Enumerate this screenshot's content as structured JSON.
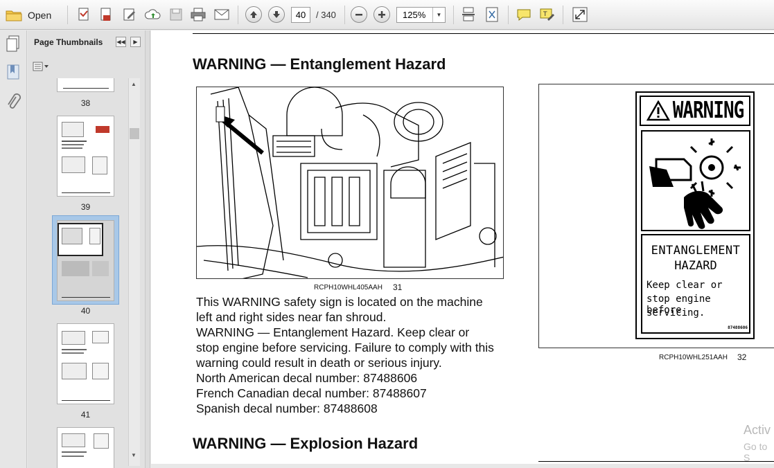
{
  "toolbar": {
    "open_label": "Open",
    "page_current": "40",
    "page_total": "/ 340",
    "zoom": "125%"
  },
  "sidebar": {
    "title": "Page Thumbnails",
    "thumbnails": [
      {
        "page": "38"
      },
      {
        "page": "39"
      },
      {
        "page": "40",
        "selected": true
      },
      {
        "page": "41"
      }
    ]
  },
  "document": {
    "heading1": "WARNING — Entanglement Hazard",
    "figure1_caption_code": "RCPH10WHL405AAH",
    "figure1_caption_num": "31",
    "figure2_caption_code": "RCPH10WHL251AAH",
    "figure2_caption_num": "32",
    "decal": {
      "header": "WARNING",
      "title1": "ENTANGLEMENT",
      "title2": "HAZARD",
      "line1": "Keep clear or",
      "line2": "stop engine before",
      "line3": "servicing.",
      "part_no": "87488606"
    },
    "body_lines": [
      "This WARNING safety sign is located on the machine",
      "left and right sides near fan shroud.",
      "WARNING — Entanglement Hazard.  Keep clear or",
      "stop engine before servicing.  Failure to comply with this",
      "warning could result in death or serious injury.",
      "North American decal number:  87488606",
      "French Canadian decal number:  87488607",
      "Spanish decal number:  87488608"
    ],
    "heading2": "WARNING — Explosion Hazard",
    "watermark_line1": "Activ",
    "watermark_line2": "Go to S"
  },
  "colors": {
    "selection": "#a8c8e8",
    "toolbar_bg": "#eeeeee"
  }
}
